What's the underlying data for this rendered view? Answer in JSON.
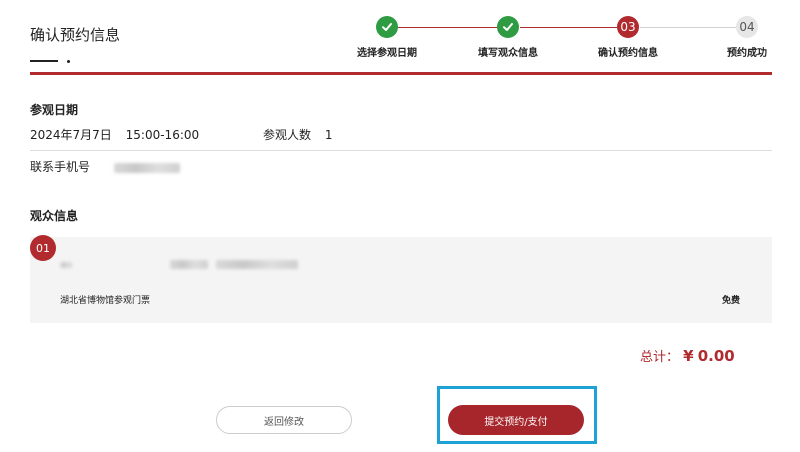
{
  "header": {
    "title": "确认预约信息"
  },
  "steps": [
    {
      "label": "选择参观日期",
      "status": "done",
      "icon": "check-icon",
      "number": ""
    },
    {
      "label": "填写观众信息",
      "status": "done",
      "icon": "check-icon",
      "number": ""
    },
    {
      "label": "确认预约信息",
      "status": "current",
      "icon": "",
      "number": "03"
    },
    {
      "label": "预约成功",
      "status": "todo",
      "icon": "",
      "number": "04"
    }
  ],
  "visit": {
    "section_title": "参观日期",
    "date": "2024年7月7日",
    "time": "15:00-16:00",
    "count_label": "参观人数",
    "count_value": "1",
    "phone_label": "联系手机号"
  },
  "visitors": {
    "section_title": "观众信息",
    "items": [
      {
        "index": "01",
        "ticket_name": "湖北省博物馆参观门票",
        "price": "免费"
      }
    ]
  },
  "total": {
    "label": "总计：",
    "currency": "¥",
    "amount": "0.00"
  },
  "actions": {
    "back_label": "返回修改",
    "submit_label": "提交预约/支付"
  },
  "colors": {
    "accent": "#b02a2e",
    "done": "#2f9b43",
    "highlight": "#1ea2d6"
  }
}
